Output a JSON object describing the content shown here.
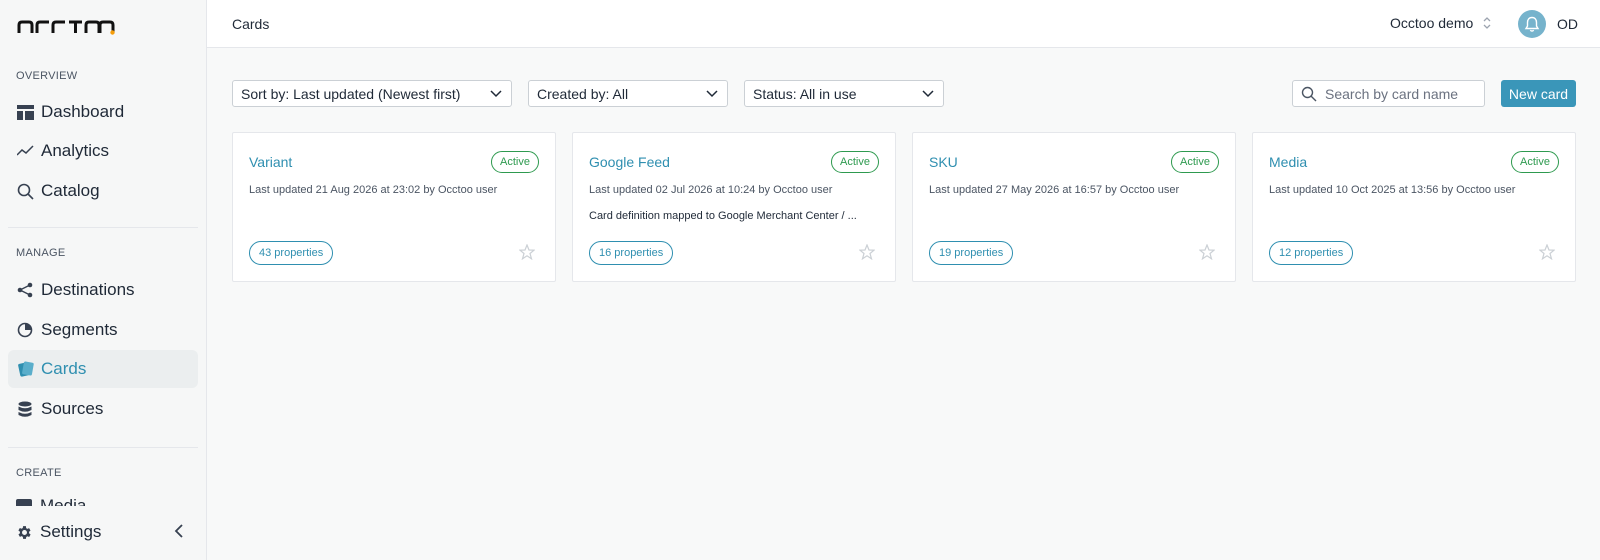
{
  "sidebar": {
    "logo_text": "occtoo.",
    "sections": {
      "overview": "OVERVIEW",
      "manage": "MANAGE",
      "create": "CREATE"
    },
    "overview_items": [
      {
        "label": "Dashboard",
        "icon": "dashboard-icon"
      },
      {
        "label": "Analytics",
        "icon": "analytics-icon"
      },
      {
        "label": "Catalog",
        "icon": "search-icon"
      }
    ],
    "manage_items": [
      {
        "label": "Destinations",
        "icon": "share-icon"
      },
      {
        "label": "Segments",
        "icon": "pie-chart-icon"
      },
      {
        "label": "Cards",
        "icon": "cards-icon",
        "active": true
      },
      {
        "label": "Sources",
        "icon": "database-icon"
      }
    ],
    "create_partial": "Media",
    "settings_label": "Settings"
  },
  "header": {
    "page_title": "Cards",
    "org_name": "Occtoo demo",
    "user_initials": "OD"
  },
  "toolbar": {
    "sort_label": "Sort by: Last updated (Newest first)",
    "created_by_label": "Created by: All",
    "status_label": "Status: All in use",
    "search_placeholder": "Search by card name",
    "new_card_label": "New card"
  },
  "cards": [
    {
      "title": "Variant",
      "status": "Active",
      "meta": "Last updated 21 Aug 2026 at 23:02 by Occtoo user",
      "description": "",
      "properties": "43 properties"
    },
    {
      "title": "Google Feed",
      "status": "Active",
      "meta": "Last updated 02 Jul 2026 at 10:24 by Occtoo user",
      "description": "Card definition mapped to Google Merchant Center / ...",
      "properties": "16 properties"
    },
    {
      "title": "SKU",
      "status": "Active",
      "meta": "Last updated 27 May 2026 at 16:57 by Occtoo user",
      "description": "",
      "properties": "19 properties"
    },
    {
      "title": "Media",
      "status": "Active",
      "meta": "Last updated 10 Oct 2025 at 13:56 by Occtoo user",
      "description": "",
      "properties": "12 properties"
    }
  ],
  "colors": {
    "accent": "#2f8fb0",
    "primary_button": "#3a96b9",
    "active_green": "#2e9a4f",
    "bell_bg": "#76b3cc"
  }
}
